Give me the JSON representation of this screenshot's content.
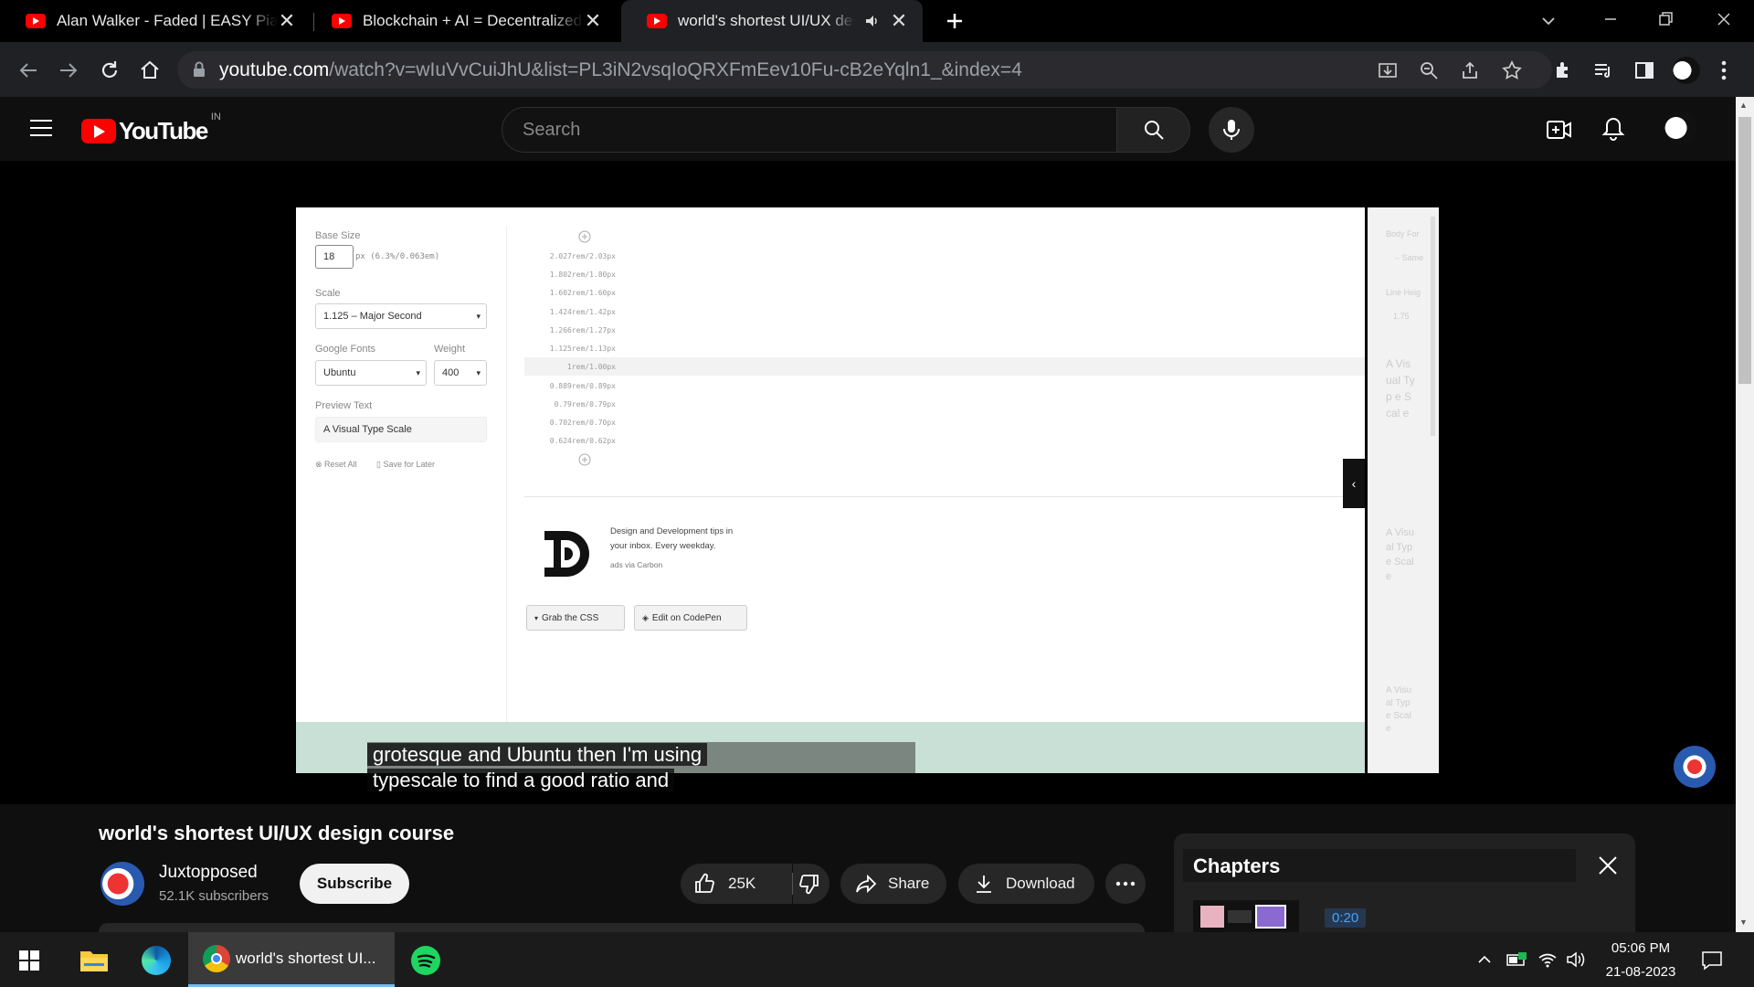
{
  "browser": {
    "tabs": [
      {
        "title": "Alan Walker - Faded | EASY Piano"
      },
      {
        "title": "Blockchain + AI = Decentralized AI"
      },
      {
        "title": "world's shortest UI/UX design course"
      }
    ],
    "url": {
      "host": "youtube.com",
      "path": "/watch?v=wIuVvCuiJhU&list=PL3iN2vsqIoQRXFmEev10Fu-cB2eYqln1_&index=4"
    }
  },
  "youtube": {
    "logo_text": "YouTube",
    "region": "IN",
    "search_placeholder": "Search"
  },
  "video_frame": {
    "base_size_label": "Base Size",
    "base_size_value": "18",
    "base_size_hint": "px (6.3%/0.063em)",
    "scale_label": "Scale",
    "scale_value": "1.125 – Major Second",
    "google_fonts_label": "Google Fonts",
    "weight_label": "Weight",
    "font_value": "Ubuntu",
    "weight_value": "400",
    "preview_label": "Preview Text",
    "preview_value": "A Visual Type Scale",
    "reset_label": "Reset All",
    "save_label": "Save for Later",
    "scale_rows": [
      "2.027rem/2.03px",
      "1.802rem/1.80px",
      "1.602rem/1.60px",
      "1.424rem/1.42px",
      "1.266rem/1.27px",
      "1.125rem/1.13px",
      "1rem/1.00px",
      "0.889rem/0.89px",
      "0.79rem/0.79px",
      "0.702rem/0.70px",
      "0.624rem/0.62px"
    ],
    "ad_line1": "Design and Development tips in",
    "ad_line2": "your inbox. Every weekday.",
    "ad_via": "ads via Carbon",
    "grab_css": "Grab the CSS",
    "edit_codepen": "Edit on CodePen",
    "side_labels": [
      "Body For",
      "– Same",
      "Line Heig",
      "1.75"
    ],
    "side_previews": [
      "A Vis ual Typ e Scal e",
      "A Visu al Typ e Scal e",
      "A Visu al Type Scal e"
    ]
  },
  "caption": {
    "line1": "grotesque and Ubuntu then I'm using",
    "line2": "typescale to find a good ratio and"
  },
  "video": {
    "title": "world's shortest UI/UX design course",
    "channel": "Juxtopposed",
    "subscribers": "52.1K subscribers",
    "subscribe": "Subscribe",
    "likes": "25K",
    "share": "Share",
    "download": "Download"
  },
  "chapters": {
    "title": "Chapters",
    "first_time": "0:20"
  },
  "taskbar": {
    "chrome_label": "world's shortest UI...",
    "time": "05:06 PM",
    "date": "21-08-2023"
  },
  "colors": {
    "youtube_red": "#ff0000",
    "caption_bg": "#080808",
    "chapter_time": "#3ea6ff"
  }
}
